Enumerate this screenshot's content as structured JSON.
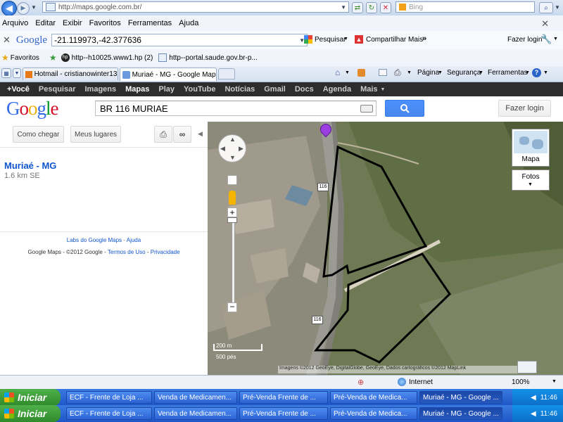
{
  "browser": {
    "address": "http://maps.google.com.br/",
    "search_placeholder": "Bing",
    "menu": [
      "Arquivo",
      "Editar",
      "Exibir",
      "Favoritos",
      "Ferramentas",
      "Ajuda"
    ],
    "toolbar": {
      "logo": "Google",
      "query": "-21.119973,-42.377636",
      "pesquisar": "Pesquisar",
      "compartilhar": "Compartilhar",
      "mais": "Mais",
      "fazer_login": "Fazer login"
    },
    "favorites": {
      "label": "Favoritos",
      "items": [
        "http--h10025.www1.hp (2)",
        "http--portal.saude.gov.br-p..."
      ]
    },
    "tabs": [
      "Hotmail - cristianowinter13@...",
      "Muriaé - MG - Google Maps"
    ],
    "commands": {
      "pagina": "Página",
      "seguranca": "Segurança",
      "ferramentas": "Ferramentas"
    }
  },
  "google": {
    "nav": [
      "+Você",
      "Pesquisar",
      "Imagens",
      "Mapas",
      "Play",
      "YouTube",
      "Notícias",
      "Gmail",
      "Docs",
      "Agenda",
      "Mais"
    ],
    "logo": "Google",
    "search_value": "BR 116 MURIAE",
    "login": "Fazer login"
  },
  "left_panel": {
    "directions": "Como chegar",
    "my_places": "Meus lugares",
    "result_title": "Muriaé - MG",
    "result_distance": "1.6 km SE",
    "labs": "Labs do Google Maps",
    "help": "Ajuda",
    "footer_prefix": "Google Maps - ©2012 Google -",
    "terms": "Termos de Uso",
    "privacy": "Privacidade"
  },
  "map": {
    "type_button": "Mapa",
    "photos_button": "Fotos",
    "scale_m": "200 m",
    "scale_ft": "500 pés",
    "route_label_1": "116",
    "route_label_2": "116",
    "attribution": "Imagens ©2012 GeoEye, DigitalGlobe, GeoEye, Dados cartográficos ©2012 MapLink"
  },
  "status": {
    "zone": "Internet",
    "zoom": "100%"
  },
  "taskbar": {
    "start": "Iniciar",
    "items": [
      "ECF - Frente de Loja ...",
      "Venda de Medicamen...",
      "Pré-Venda Frente de ...",
      "Pré-Venda de Medica...",
      "Muriaé - MG - Google ..."
    ],
    "clock": "11:46"
  },
  "colors": {
    "accent": "#4d90fe",
    "link": "#1155cc",
    "gbar": "#2d2d2d",
    "taskbar": "#245edb",
    "start": "#3c9b37"
  }
}
